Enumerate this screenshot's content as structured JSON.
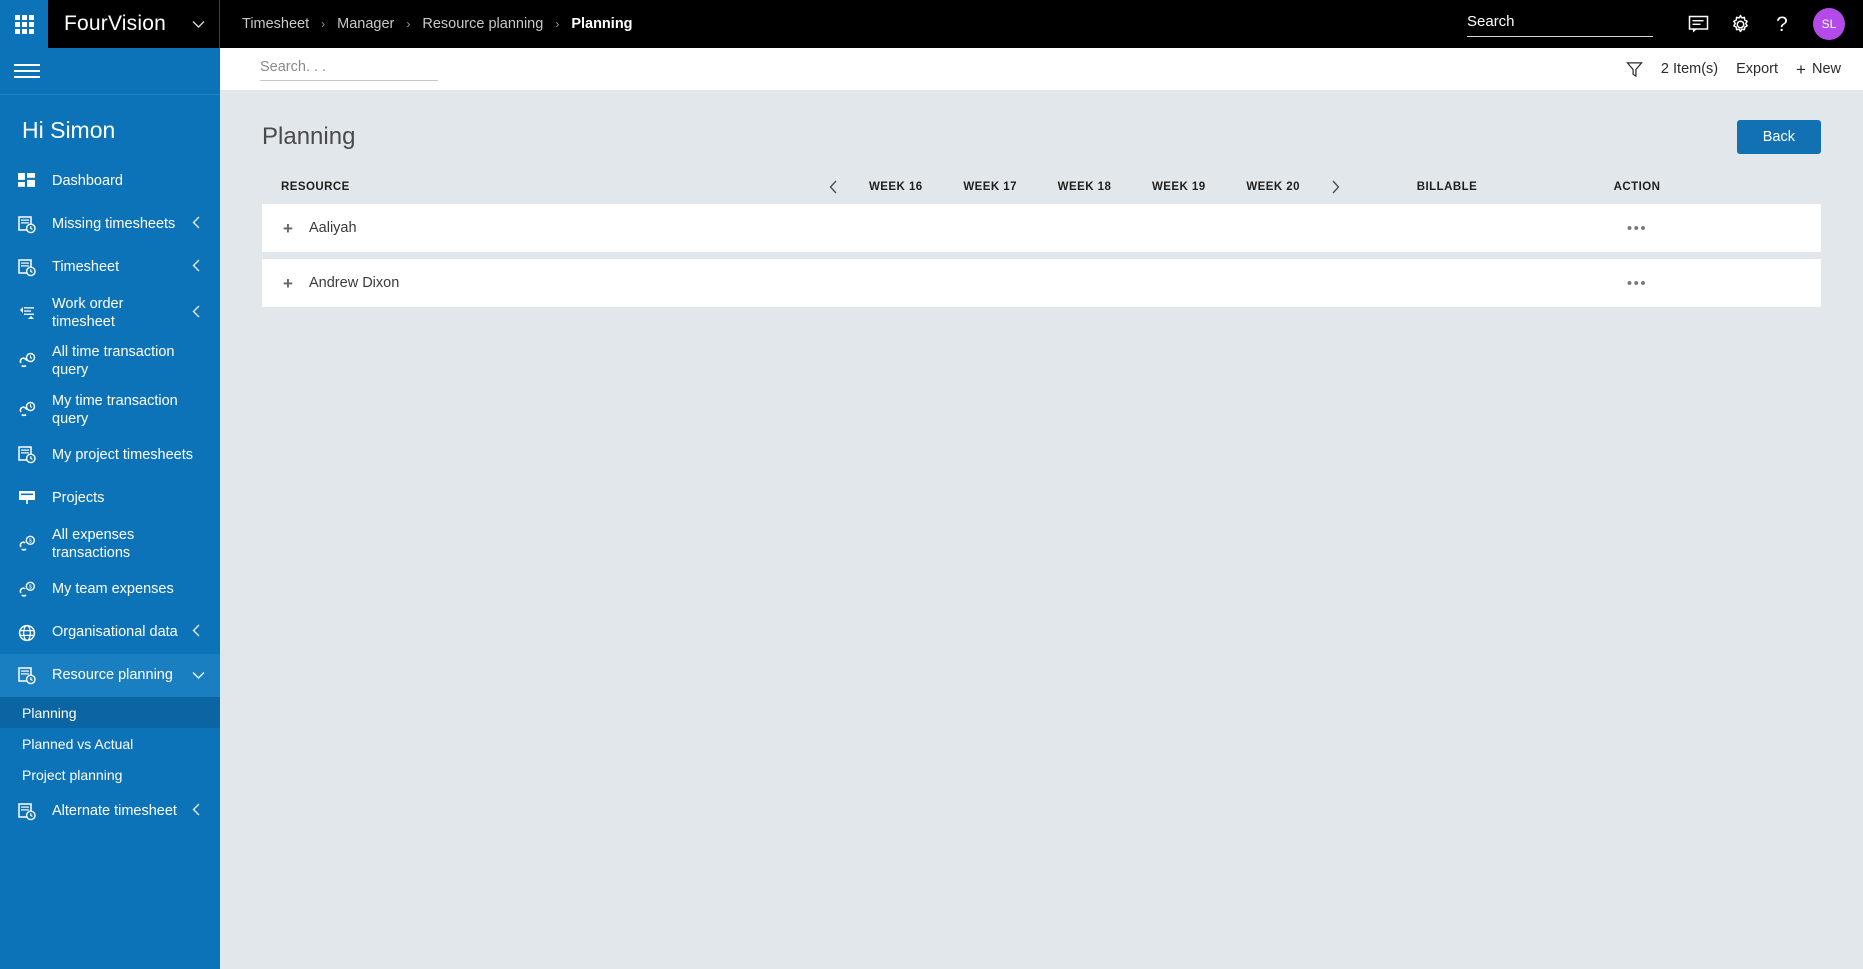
{
  "topbar": {
    "waffle_icon": "waffle-grid-icon",
    "brand": "FourVision",
    "brand_chevron_icon": "chevron-down-icon",
    "breadcrumb": [
      {
        "label": "Timesheet",
        "current": false
      },
      {
        "label": "Manager",
        "current": false
      },
      {
        "label": "Resource planning",
        "current": false
      },
      {
        "label": "Planning",
        "current": true
      }
    ],
    "breadcrumb_separator": "›",
    "search": {
      "value": "",
      "placeholder": "Search"
    },
    "icons": [
      {
        "name": "feedback-chat-icon"
      },
      {
        "name": "settings-gear-icon"
      },
      {
        "name": "help-question-icon",
        "glyph": "?"
      }
    ],
    "avatar": {
      "initials": "SL",
      "color": "#b44ae8"
    }
  },
  "sidebar": {
    "menu_icon": "hamburger-menu-icon",
    "greeting": "Hi Simon",
    "background_color": "#0c73b8",
    "items": [
      {
        "label": "Dashboard",
        "icon": "dashboard-tiles-icon",
        "chevron": null,
        "active": false
      },
      {
        "label": "Missing timesheets",
        "icon": "timesheet-clock-icon",
        "chevron": "chevron-left-icon",
        "active": false
      },
      {
        "label": "Timesheet",
        "icon": "timesheet-clock-icon",
        "chevron": "chevron-left-icon",
        "active": false
      },
      {
        "label": "Work order timesheet",
        "icon": "work-order-icon",
        "chevron": "chevron-left-icon",
        "active": false
      },
      {
        "label": "All time transaction query",
        "icon": "link-clock-icon",
        "chevron": null,
        "active": false
      },
      {
        "label": "My time transaction query",
        "icon": "link-clock-icon",
        "chevron": null,
        "active": false
      },
      {
        "label": "My project timesheets",
        "icon": "timesheet-clock-icon",
        "chevron": null,
        "active": false
      },
      {
        "label": "Projects",
        "icon": "projects-board-icon",
        "chevron": null,
        "active": false
      },
      {
        "label": "All expenses transactions",
        "icon": "expenses-coin-icon",
        "chevron": null,
        "active": false
      },
      {
        "label": "My team expenses",
        "icon": "expenses-coin-icon",
        "chevron": null,
        "active": false
      },
      {
        "label": "Organisational data",
        "icon": "globe-icon",
        "chevron": "chevron-left-icon",
        "active": false
      },
      {
        "label": "Resource planning",
        "icon": "timesheet-clock-icon",
        "chevron": "chevron-down-icon",
        "active": true
      }
    ],
    "sub_items": [
      {
        "label": "Planning",
        "active": true
      },
      {
        "label": "Planned vs Actual",
        "active": false
      },
      {
        "label": "Project planning",
        "active": false
      }
    ],
    "items_after": [
      {
        "label": "Alternate timesheet",
        "icon": "timesheet-clock-icon",
        "chevron": "chevron-left-icon",
        "active": false
      }
    ]
  },
  "toolbar": {
    "search": {
      "value": "",
      "placeholder": "Search. . ."
    },
    "filter_icon": "filter-funnel-icon",
    "item_count": "2 Item(s)",
    "export_label": "Export",
    "new_label": "New",
    "new_plus": "+"
  },
  "page": {
    "title": "Planning",
    "back_label": "Back"
  },
  "table": {
    "columns": {
      "resource": "RESOURCE",
      "billable": "BILLABLE",
      "action": "ACTION"
    },
    "week_prev_icon": "chevron-left-icon",
    "week_next_icon": "chevron-right-icon",
    "weeks": [
      "WEEK 16",
      "WEEK 17",
      "WEEK 18",
      "WEEK 19",
      "WEEK 20"
    ],
    "rows": [
      {
        "expand": "+",
        "resource": "Aaliyah",
        "billable": "",
        "action": "•••"
      },
      {
        "expand": "+",
        "resource": "Andrew Dixon",
        "billable": "",
        "action": "•••"
      }
    ]
  }
}
